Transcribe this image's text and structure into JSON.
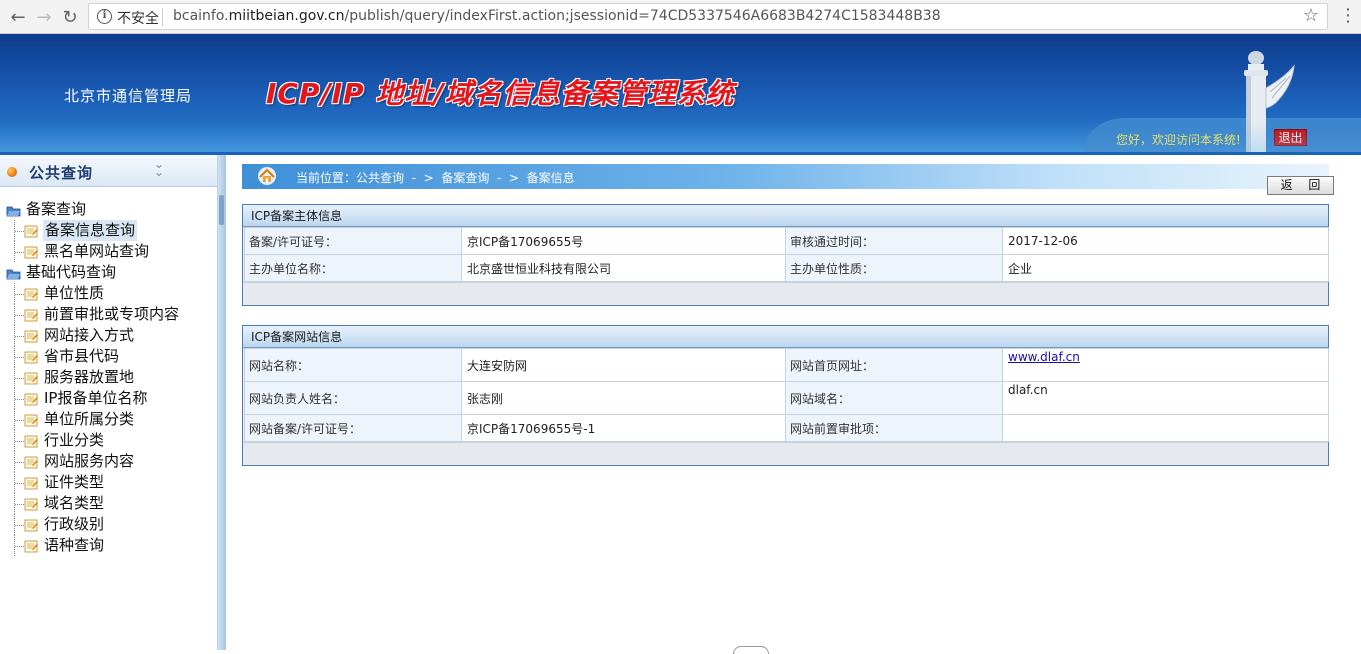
{
  "browser": {
    "insecure_label": "不安全",
    "url_prefix": "bcainfo.",
    "url_host": "miitbeian.gov.cn",
    "url_path": "/publish/query/indexFirst.action;jsessionid=74CD5337546A6683B4274C1583448B38",
    "back_icon": "arrow-left-icon",
    "forward_icon": "arrow-right-icon",
    "reload_icon": "reload-icon",
    "bookmark_icon": "star-icon"
  },
  "header": {
    "bureau_name": "北京市通信管理局",
    "system_title": "ICP/IP 地址/域名信息备案管理系统",
    "welcome_text": "您好，欢迎访问本系统!",
    "logout_label": "退出"
  },
  "sidebar": {
    "title": "公共查询",
    "groups": [
      {
        "label": "备案查询",
        "items": [
          {
            "label": "备案信息查询",
            "active": true
          },
          {
            "label": "黑名单网站查询",
            "active": false
          }
        ]
      },
      {
        "label": "基础代码查询",
        "items": [
          {
            "label": "单位性质"
          },
          {
            "label": "前置审批或专项内容"
          },
          {
            "label": "网站接入方式"
          },
          {
            "label": "省市县代码"
          },
          {
            "label": "服务器放置地"
          },
          {
            "label": "IP报备单位名称"
          },
          {
            "label": "单位所属分类"
          },
          {
            "label": "行业分类"
          },
          {
            "label": "网站服务内容"
          },
          {
            "label": "证件类型"
          },
          {
            "label": "域名类型"
          },
          {
            "label": "行政级别"
          },
          {
            "label": "语种查询"
          }
        ]
      }
    ]
  },
  "breadcrumb": {
    "prefix": "当前位置：",
    "items": [
      "公共查询",
      "备案查询",
      "备案信息"
    ],
    "separator": " - > ",
    "back_label": "返 回"
  },
  "subject_panel": {
    "title": "ICP备案主体信息",
    "rows": [
      {
        "label1": "备案/许可证号：",
        "value1": "京ICP备17069655号",
        "label2": "审核通过时间：",
        "value2": "2017-12-06"
      },
      {
        "label1": "主办单位名称：",
        "value1": "北京盛世恒业科技有限公司",
        "label2": "主办单位性质：",
        "value2": "企业"
      }
    ]
  },
  "website_panel": {
    "title": "ICP备案网站信息",
    "rows": [
      {
        "label1": "网站名称：",
        "value1": "大连安防网",
        "label2": "网站首页网址：",
        "value2": "www.dlaf.cn"
      },
      {
        "label1": "网站负责人姓名：",
        "value1": "张志刚",
        "label2": "网站域名：",
        "value2": "dlaf.cn"
      },
      {
        "label1": "网站备案/许可证号：",
        "value1": "京ICP备17069655号-1",
        "label2": "网站前置审批项：",
        "value2": ""
      }
    ]
  },
  "colors": {
    "banner": "#1a5cb5",
    "title_red": "#e3161c",
    "welcome_yellow": "#ffe94a",
    "panel_border": "#4a7db6"
  }
}
